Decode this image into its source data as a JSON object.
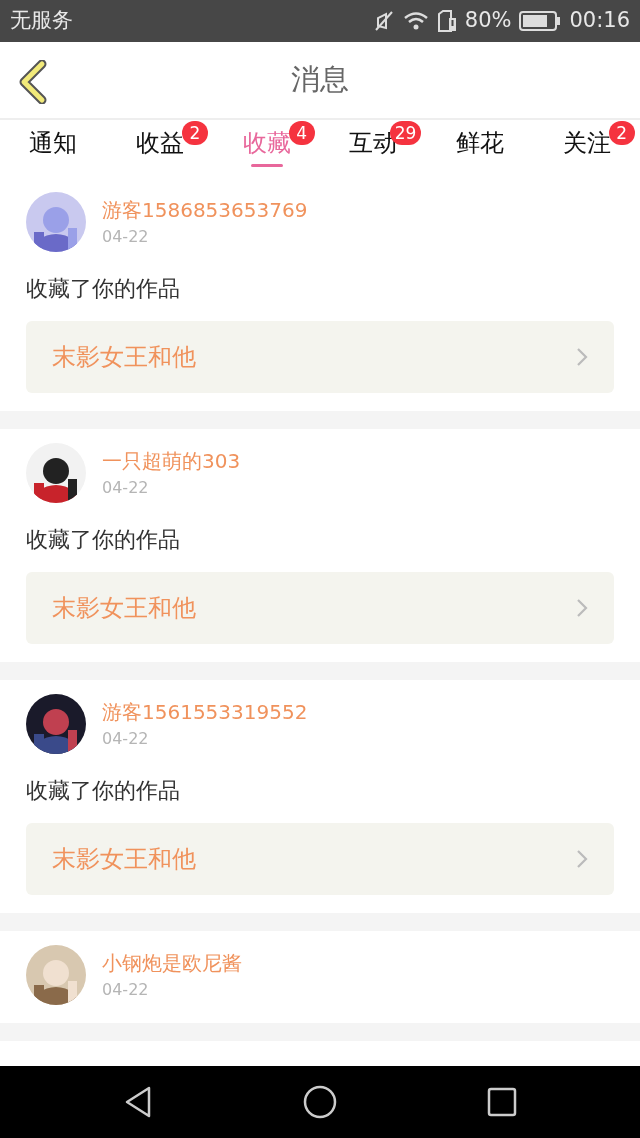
{
  "status_bar": {
    "carrier": "无服务",
    "battery": "80%",
    "time": "00:16"
  },
  "header": {
    "title": "消息"
  },
  "tabs": [
    {
      "label": "通知",
      "selected": false
    },
    {
      "label": "收益",
      "selected": false,
      "badge": "2"
    },
    {
      "label": "收藏",
      "selected": true,
      "badge": "4"
    },
    {
      "label": "互动",
      "selected": false,
      "badge": "29"
    },
    {
      "label": "鲜花",
      "selected": false
    },
    {
      "label": "关注",
      "selected": false,
      "badge": "2"
    }
  ],
  "messages": [
    {
      "user": "游客1586853653769",
      "date": "04-22",
      "action": "收藏了你的作品",
      "work": "末影女王和他"
    },
    {
      "user": "一只超萌的303",
      "date": "04-22",
      "action": "收藏了你的作品",
      "work": "末影女王和他"
    },
    {
      "user": "游客1561553319552",
      "date": "04-22",
      "action": "收藏了你的作品",
      "work": "末影女王和他"
    },
    {
      "user": "小钢炮是欧尼酱",
      "date": "04-22"
    }
  ]
}
